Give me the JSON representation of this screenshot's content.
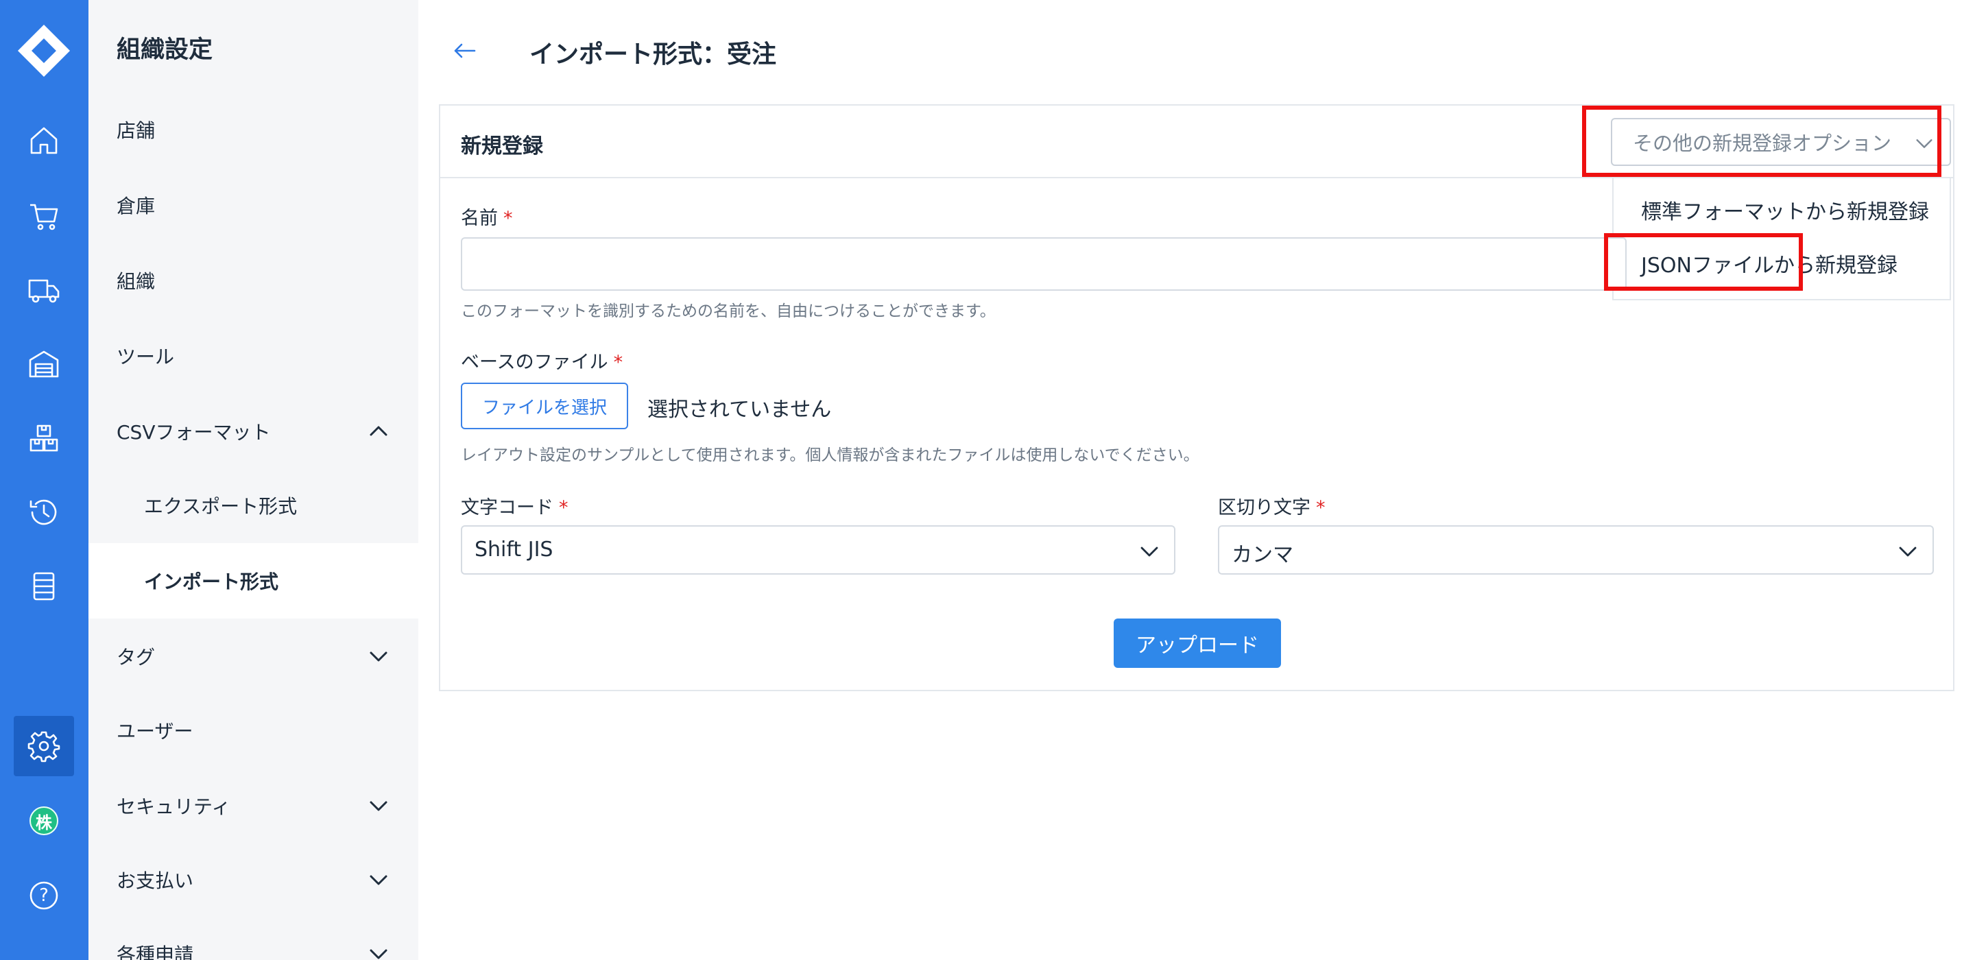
{
  "rail": {
    "icons": [
      "logo-icon",
      "home-icon",
      "cart-icon",
      "truck-icon",
      "warehouse-icon",
      "boxes-icon",
      "history-icon",
      "list-icon",
      "gear-icon",
      "company-icon",
      "help-icon"
    ],
    "company_badge": "株",
    "help_glyph": "?"
  },
  "subnav": {
    "title": "組織設定",
    "items": [
      {
        "label": "店舗"
      },
      {
        "label": "倉庫"
      },
      {
        "label": "組織"
      },
      {
        "label": "ツール"
      },
      {
        "label": "CSVフォーマット",
        "expanded": true
      },
      {
        "label": "エクスポート形式"
      },
      {
        "label": "インポート形式",
        "selected": true
      },
      {
        "label": "タグ"
      },
      {
        "label": "ユーザー"
      },
      {
        "label": "セキュリティ"
      },
      {
        "label": "お支払い"
      },
      {
        "label": "各種申請"
      }
    ]
  },
  "page": {
    "title": "インポート形式：受注"
  },
  "card": {
    "title": "新規登録",
    "options_button": "その他の新規登録オプション",
    "dropdown": {
      "items": [
        "標準フォーマットから新規登録",
        "JSONファイルから新規登録"
      ],
      "highlighted_index": 1
    },
    "name_field": {
      "label": "名前",
      "required_mark": "*",
      "value": "",
      "help": "このフォーマットを識別するための名前を、自由につけることができます。"
    },
    "base_file": {
      "label": "ベースのファイル",
      "required_mark": "*",
      "button": "ファイルを選択",
      "status": "選択されていません",
      "help": "レイアウト設定のサンプルとして使用されます。個人情報が含まれたファイルは使用しないでください。"
    },
    "encoding": {
      "label": "文字コード",
      "required_mark": "*",
      "value": "Shift JIS"
    },
    "delimiter": {
      "label": "区切り文字",
      "required_mark": "*",
      "value": "カンマ"
    },
    "upload_button": "アップロード"
  },
  "colors": {
    "rail": "#2f7ae5",
    "rail_active": "#1c60c4",
    "primary": "#2f88ea",
    "highlight": "#ee1010",
    "required": "#e02424"
  }
}
